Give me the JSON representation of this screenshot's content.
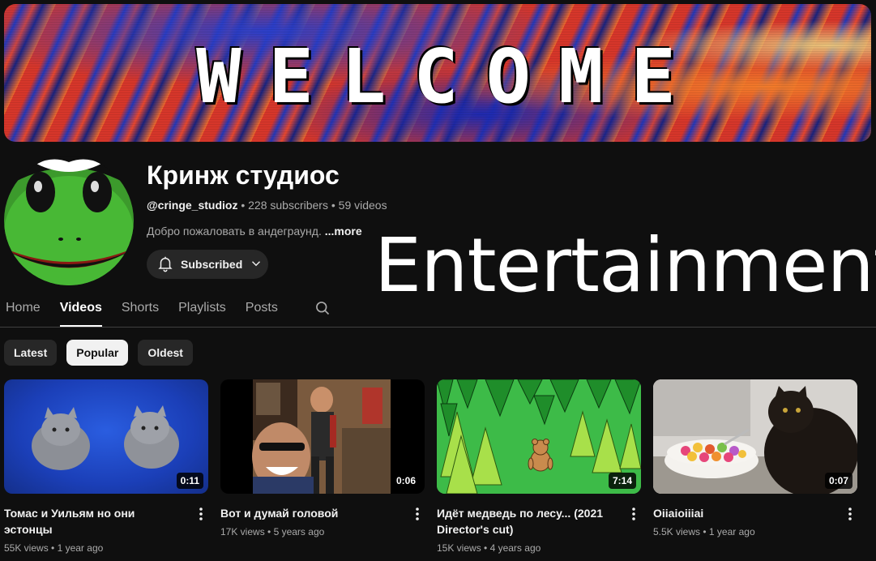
{
  "banner": {
    "text": "WELCOME"
  },
  "channel": {
    "name": "Кринж студиос",
    "handle": "@cringe_studioz",
    "subscribers": "228 subscribers",
    "video_count": "59 videos",
    "separator": " • ",
    "description": "Добро пожаловать в андеграунд.",
    "more_label": "...more",
    "subscribe_label": "Subscribed"
  },
  "overlay": {
    "text": "Entertainment"
  },
  "tabs": [
    {
      "label": "Home"
    },
    {
      "label": "Videos"
    },
    {
      "label": "Shorts"
    },
    {
      "label": "Playlists"
    },
    {
      "label": "Posts"
    }
  ],
  "active_tab": "Videos",
  "chips": [
    {
      "label": "Latest"
    },
    {
      "label": "Popular"
    },
    {
      "label": "Oldest"
    }
  ],
  "active_chip": "Popular",
  "videos": [
    {
      "title": "Томас и Уильям но они эстонцы",
      "views": "55K views",
      "age": "1 year ago",
      "duration": "0:11"
    },
    {
      "title": "Вот и думай головой",
      "views": "17K views",
      "age": "5 years ago",
      "duration": "0:06"
    },
    {
      "title": "Идёт медведь по лесу... (2021 Director's cut)",
      "views": "15K views",
      "age": "4 years ago",
      "duration": "7:14"
    },
    {
      "title": "Oiiaioiiiai",
      "views": "5.5K views",
      "age": "1 year ago",
      "duration": "0:07"
    }
  ],
  "icons": {
    "bell": "bell-icon",
    "chevron": "chevron-down-icon",
    "search": "search-icon",
    "more": "more-vert-icon"
  },
  "colors": {
    "background": "#0f0f0f",
    "chip": "#272727",
    "chip_active": "#f1f1f1",
    "text_secondary": "#aaaaaa"
  }
}
